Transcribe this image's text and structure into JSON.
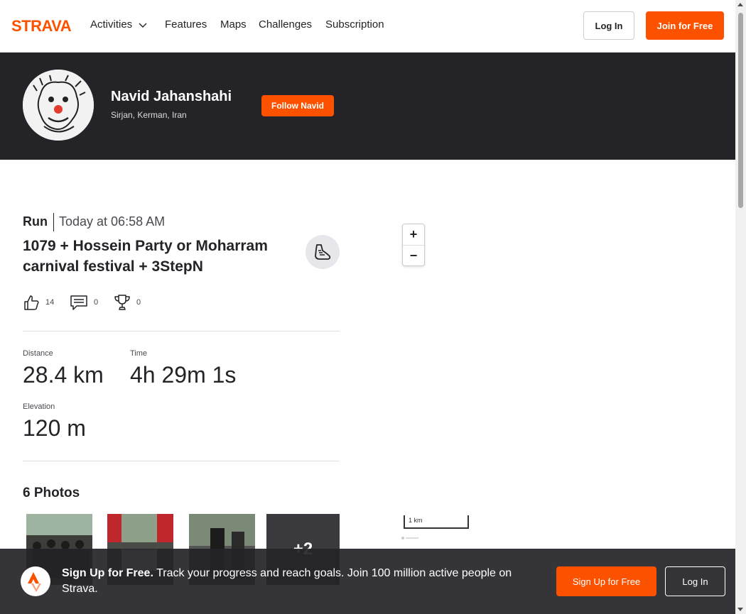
{
  "nav": {
    "logo_text": "STRAVA",
    "items": [
      {
        "label": "Activities"
      },
      {
        "label": "Features"
      },
      {
        "label": "Maps"
      },
      {
        "label": "Challenges"
      },
      {
        "label": "Subscription"
      }
    ],
    "login_label": "Log In",
    "join_label": "Join for Free"
  },
  "athlete": {
    "name": "Navid Jahanshahi",
    "location": "Sirjan, Kerman, Iran",
    "follow_label": "Follow Navid"
  },
  "activity": {
    "type": "Run",
    "date": "Today at 06:58 AM",
    "title": "1079 + Hossein Party or Moharram carnival festival + 3StepN",
    "kudos": "14",
    "comments": "0",
    "achievements": "0",
    "stats": {
      "distance_label": "Distance",
      "distance_value": "28.4 km",
      "time_label": "Time",
      "time_value": "4h 29m 1s",
      "elevation_label": "Elevation",
      "elevation_value": "120 m"
    },
    "photos_title": "6 Photos",
    "photos_more": "+2"
  },
  "map": {
    "zoom_in": "+",
    "zoom_out": "−",
    "scale_label": "1 km"
  },
  "signup": {
    "headline": "Sign Up for Free.",
    "body": "Track your progress and reach goals. Join 100 million active people on Strava.",
    "signup_label": "Sign Up for Free",
    "login_label": "Log In"
  },
  "colors": {
    "brand": "#fc5200",
    "dark": "#242428"
  }
}
